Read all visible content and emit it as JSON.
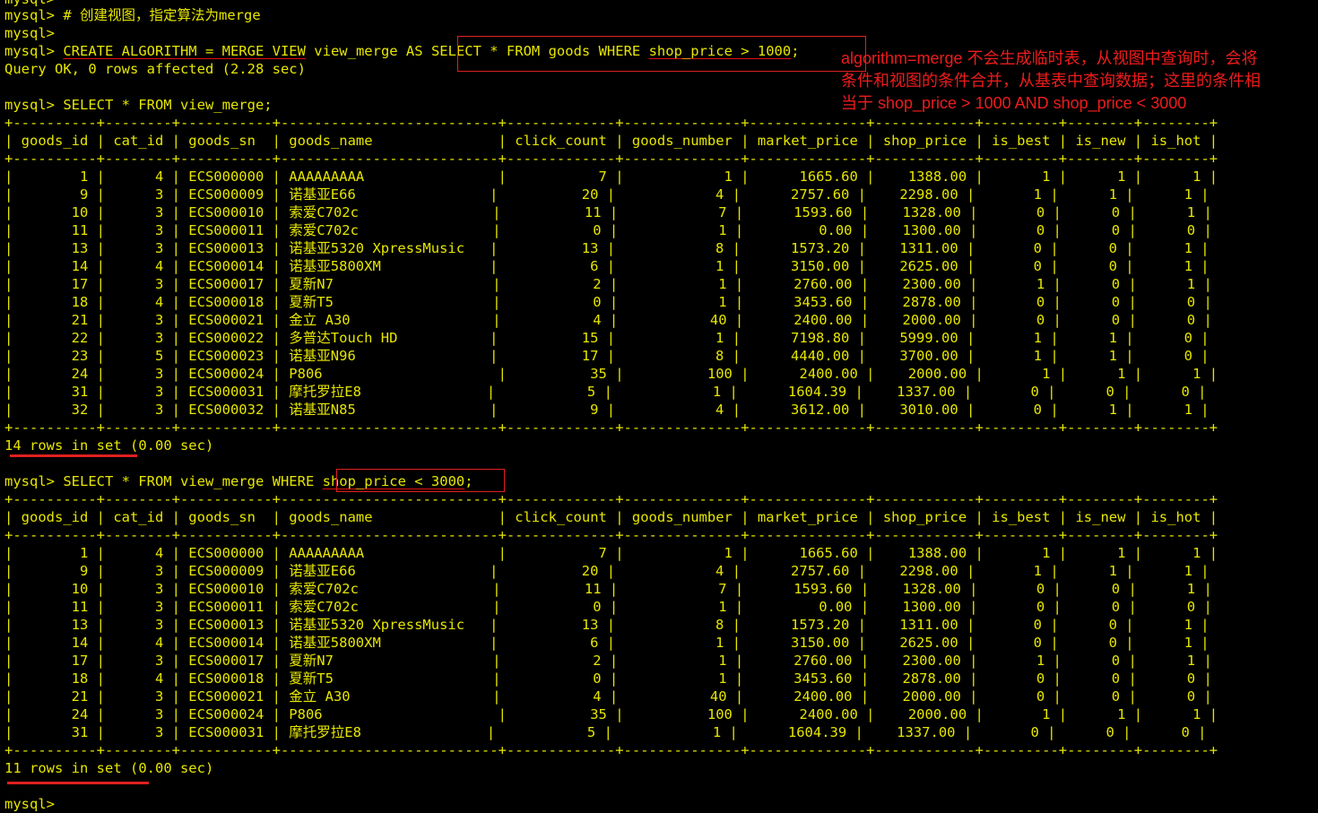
{
  "terminal": {
    "cutoff_line": "mysql>",
    "lines": {
      "l1": "mysql> # 创建视图，指定算法为merge",
      "l2": "mysql>",
      "l3_prompt": "mysql> ",
      "l3_create": "CREATE ALGORITHM = MERGE VIEW",
      "l3_mid": " view_merge AS ",
      "l3_select": "SELECT * FROM goods WHERE ",
      "l3_cond": "shop_price > 1000",
      "l3_end": ";",
      "l4": "Query OK, 0 rows affected (2.28 sec)",
      "l6": "mysql> SELECT * FROM view_merge;",
      "l2q_prompt": "mysql> SELECT * FROM view_merge WHERE ",
      "l2q_cond": "shop_price < 3000",
      "l2q_end": ";",
      "last_prompt": "mysql>"
    },
    "annotation": {
      "line1": "algorithm=merge 不会生成临时表，从视图中查询时，会将",
      "line2": "条件和视图的条件合并，从基表中查询数据；这里的条件相",
      "line3": "当于 shop_price > 1000 AND shop_price < 3000"
    }
  },
  "table1": {
    "sep": "+----------+--------+-----------+--------------------------+-------------+--------------+--------------+------------+---------+--------+--------+",
    "header": "| goods_id | cat_id | goods_sn  | goods_name               | click_count | goods_number | market_price | shop_price | is_best | is_new | is_hot |",
    "rows": [
      "|        1 |      4 | ECS000000 | AAAAAAAAA                |           7 |            1 |      1665.60 |    1388.00 |       1 |      1 |      1 |",
      "|        9 |      3 | ECS000009 | 诺基亚E66                |          20 |            4 |      2757.60 |    2298.00 |       1 |      1 |      1 |",
      "|       10 |      3 | ECS000010 | 索爱C702c                |          11 |            7 |      1593.60 |    1328.00 |       0 |      0 |      1 |",
      "|       11 |      3 | ECS000011 | 索爱C702c                |           0 |            1 |         0.00 |    1300.00 |       0 |      0 |      0 |",
      "|       13 |      3 | ECS000013 | 诺基亚5320 XpressMusic   |          13 |            8 |      1573.20 |    1311.00 |       0 |      0 |      1 |",
      "|       14 |      4 | ECS000014 | 诺基亚5800XM             |           6 |            1 |      3150.00 |    2625.00 |       0 |      0 |      1 |",
      "|       17 |      3 | ECS000017 | 夏新N7                   |           2 |            1 |      2760.00 |    2300.00 |       1 |      0 |      1 |",
      "|       18 |      4 | ECS000018 | 夏新T5                   |           0 |            1 |      3453.60 |    2878.00 |       0 |      0 |      0 |",
      "|       21 |      3 | ECS000021 | 金立 A30                 |           4 |           40 |      2400.00 |    2000.00 |       0 |      0 |      0 |",
      "|       22 |      3 | ECS000022 | 多普达Touch HD           |          15 |            1 |      7198.80 |    5999.00 |       1 |      1 |      0 |",
      "|       23 |      5 | ECS000023 | 诺基亚N96                |          17 |            8 |      4440.00 |    3700.00 |       1 |      1 |      0 |",
      "|       24 |      3 | ECS000024 | P806                     |          35 |          100 |      2400.00 |    2000.00 |       1 |      1 |      1 |",
      "|       31 |      3 | ECS000031 | 摩托罗拉E8               |           5 |            1 |      1604.39 |    1337.00 |       0 |      0 |      0 |",
      "|       32 |      3 | ECS000032 | 诺基亚N85                |           9 |            4 |      3612.00 |    3010.00 |       0 |      1 |      1 |"
    ],
    "footer_count": "14 rows in set",
    "footer_time": " (0.00 sec)"
  },
  "table2": {
    "rows": [
      "|        1 |      4 | ECS000000 | AAAAAAAAA                |           7 |            1 |      1665.60 |    1388.00 |       1 |      1 |      1 |",
      "|        9 |      3 | ECS000009 | 诺基亚E66                |          20 |            4 |      2757.60 |    2298.00 |       1 |      1 |      1 |",
      "|       10 |      3 | ECS000010 | 索爱C702c                |          11 |            7 |      1593.60 |    1328.00 |       0 |      0 |      1 |",
      "|       11 |      3 | ECS000011 | 索爱C702c                |           0 |            1 |         0.00 |    1300.00 |       0 |      0 |      0 |",
      "|       13 |      3 | ECS000013 | 诺基亚5320 XpressMusic   |          13 |            8 |      1573.20 |    1311.00 |       0 |      0 |      1 |",
      "|       14 |      4 | ECS000014 | 诺基亚5800XM             |           6 |            1 |      3150.00 |    2625.00 |       0 |      0 |      1 |",
      "|       17 |      3 | ECS000017 | 夏新N7                   |           2 |            1 |      2760.00 |    2300.00 |       1 |      0 |      1 |",
      "|       18 |      4 | ECS000018 | 夏新T5                   |           0 |            1 |      3453.60 |    2878.00 |       0 |      0 |      0 |",
      "|       21 |      3 | ECS000021 | 金立 A30                 |           4 |           40 |      2400.00 |    2000.00 |       0 |      0 |      0 |",
      "|       24 |      3 | ECS000024 | P806                     |          35 |          100 |      2400.00 |    2000.00 |       1 |      1 |      1 |",
      "|       31 |      3 | ECS000031 | 摩托罗拉E8               |           5 |            1 |      1604.39 |    1337.00 |       0 |      0 |      0 |"
    ],
    "footer_count": "11 rows in set",
    "footer_time": " (0.00 sec)"
  },
  "colors": {
    "text": "#e6e600",
    "background": "#000000",
    "annotation": "#ee1c1c"
  }
}
